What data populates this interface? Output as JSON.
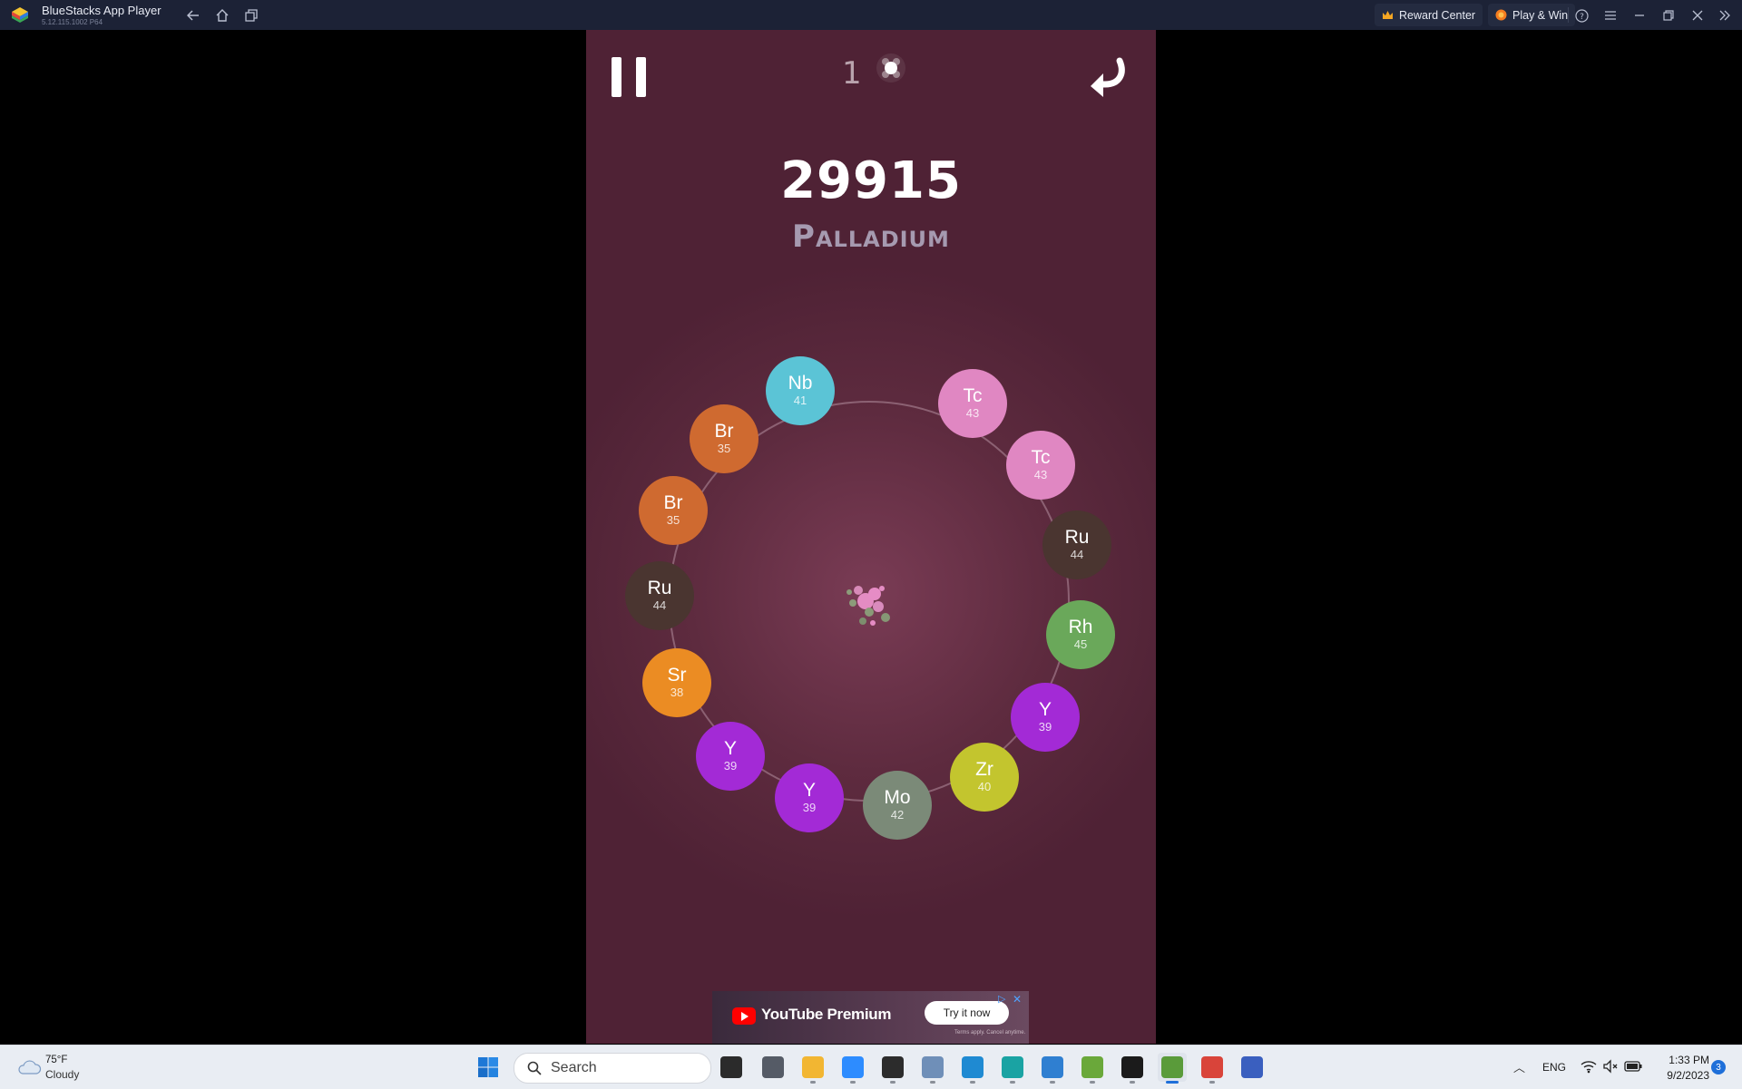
{
  "titlebar": {
    "app_title": "BlueStacks App Player",
    "app_version": "5.12.115.1002 P64",
    "reward_center_label": "Reward Center",
    "play_win_label": "Play & Win"
  },
  "game": {
    "plus_count": "1",
    "score": "29915",
    "element_name": "Palladium",
    "atoms": [
      {
        "symbol": "Nb",
        "number": "41",
        "color": "#5bc4d6"
      },
      {
        "symbol": "Tc",
        "number": "43",
        "color": "#e087c2"
      },
      {
        "symbol": "Tc",
        "number": "43",
        "color": "#e087c2"
      },
      {
        "symbol": "Ru",
        "number": "44",
        "color": "#4a3530"
      },
      {
        "symbol": "Rh",
        "number": "45",
        "color": "#6aa85a"
      },
      {
        "symbol": "Y",
        "number": "39",
        "color": "#a32ad6"
      },
      {
        "symbol": "Zr",
        "number": "40",
        "color": "#c3c52e"
      },
      {
        "symbol": "Mo",
        "number": "42",
        "color": "#7b8a78"
      },
      {
        "symbol": "Y",
        "number": "39",
        "color": "#a32ad6"
      },
      {
        "symbol": "Y",
        "number": "39",
        "color": "#a32ad6"
      },
      {
        "symbol": "Sr",
        "number": "38",
        "color": "#eb8c23"
      },
      {
        "symbol": "Ru",
        "number": "44",
        "color": "#4a3530"
      },
      {
        "symbol": "Br",
        "number": "35",
        "color": "#cf6a30"
      },
      {
        "symbol": "Br",
        "number": "35",
        "color": "#cf6a30"
      }
    ]
  },
  "ad": {
    "title": "YouTube Premium",
    "cta": "Try it now",
    "terms": "Terms apply. Cancel anytime."
  },
  "taskbar": {
    "weather_temp": "75°F",
    "weather_condition": "Cloudy",
    "search_label": "Search",
    "language": "ENG",
    "time": "1:33 PM",
    "date": "9/2/2023",
    "notification_count": "3",
    "apps": [
      {
        "name": "task-view",
        "color": "#2b2b2b"
      },
      {
        "name": "app-dark",
        "color": "#555b66"
      },
      {
        "name": "file-explorer",
        "color": "#f2b632"
      },
      {
        "name": "zoom",
        "color": "#2d8cff"
      },
      {
        "name": "terminal",
        "color": "#2c2c2c"
      },
      {
        "name": "image-viewer",
        "color": "#6f8fb8"
      },
      {
        "name": "vscode",
        "color": "#1f8ad2"
      },
      {
        "name": "edge",
        "color": "#1aa3a3"
      },
      {
        "name": "photos",
        "color": "#2f7fd1"
      },
      {
        "name": "notepad-chart",
        "color": "#6aa83a"
      },
      {
        "name": "console",
        "color": "#1b1b1b"
      },
      {
        "name": "bluestacks",
        "color": "#5a9b3a"
      },
      {
        "name": "snipping-tool",
        "color": "#d9443a"
      },
      {
        "name": "app-blue",
        "color": "#3a5fbf"
      }
    ]
  }
}
